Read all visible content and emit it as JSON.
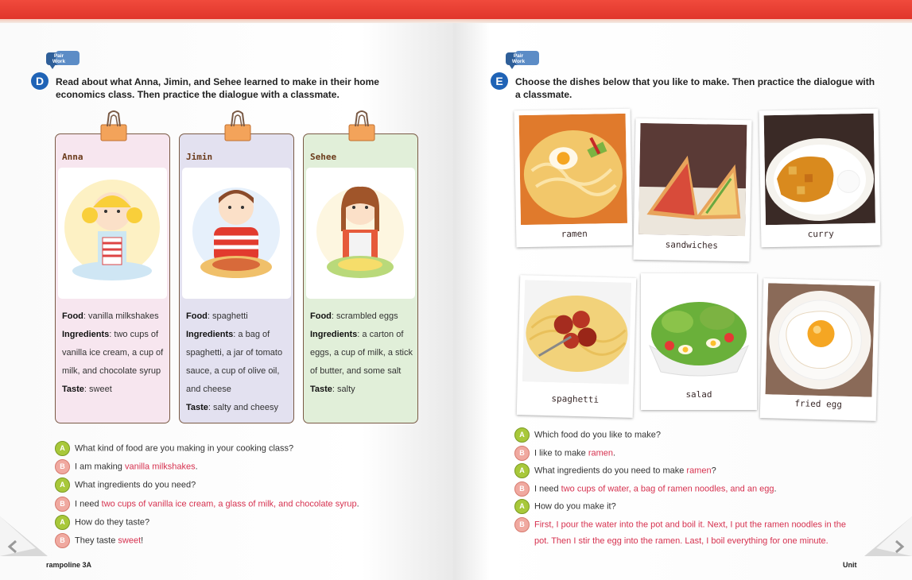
{
  "left": {
    "pair_label": "Pair\nWork",
    "letter": "D",
    "instruction": "Read about what Anna, Jimin, and Sehee learned to make in their home economics class. Then practice the dialogue with a classmate.",
    "cards": [
      {
        "name": "Anna",
        "food_label": "Food",
        "food": ": vanilla milkshakes",
        "ing_label": "Ingredients",
        "ing": ": two cups of vanilla ice cream, a cup of milk, and chocolate syrup",
        "taste_label": "Taste",
        "taste": ": sweet",
        "color": "#f7e6ef"
      },
      {
        "name": "Jimin",
        "food_label": "Food",
        "food": ": spaghetti",
        "ing_label": "Ingredients",
        "ing": ": a bag of spaghetti, a jar of tomato sauce,  a cup of olive oil, and cheese",
        "taste_label": "Taste",
        "taste": ": salty and cheesy",
        "color": "#e3e1f0"
      },
      {
        "name": "Sehee",
        "food_label": "Food",
        "food": ": scrambled eggs",
        "ing_label": "Ingredients",
        "ing": ": a carton of eggs, a cup of milk, a stick of butter, and some salt",
        "taste_label": "Taste",
        "taste": ": salty",
        "color": "#e1efd9"
      }
    ],
    "dialogue": [
      {
        "s": "A",
        "pre": "What kind of food are you making in your cooking class?",
        "hl": "",
        "post": ""
      },
      {
        "s": "B",
        "pre": "I am making ",
        "hl": "vanilla milkshakes",
        "post": "."
      },
      {
        "s": "A",
        "pre": "What ingredients do you need?",
        "hl": "",
        "post": ""
      },
      {
        "s": "B",
        "pre": "I need ",
        "hl": "two cups of vanilla ice cream, a glass of milk, and chocolate syrup",
        "post": "."
      },
      {
        "s": "A",
        "pre": "How do they taste?",
        "hl": "",
        "post": ""
      },
      {
        "s": "B",
        "pre": "They taste ",
        "hl": "sweet",
        "post": "!"
      }
    ],
    "footer": "rampoline 3A"
  },
  "right": {
    "pair_label": "Pair\nWork",
    "letter": "E",
    "instruction": "Choose the dishes below that you like to make. Then practice the dialogue with a classmate.",
    "photos": [
      "ramen",
      "sandwiches",
      "curry",
      "spaghetti",
      "salad",
      "fried egg"
    ],
    "dialogue": [
      {
        "s": "A",
        "pre": "Which food do you like to make?",
        "hl": "",
        "post": ""
      },
      {
        "s": "B",
        "pre": "I like to make ",
        "hl": "ramen",
        "post": "."
      },
      {
        "s": "A",
        "pre": "What ingredients do you need to make ",
        "hl": "ramen",
        "post": "?"
      },
      {
        "s": "B",
        "pre": "I need ",
        "hl": "two cups of water, a bag of ramen noodles, and an egg",
        "post": "."
      },
      {
        "s": "A",
        "pre": "How do you make it?",
        "hl": "",
        "post": ""
      },
      {
        "s": "B",
        "pre": "",
        "hl": "First, I pour the water into the pot and boil it. Next, I put the ramen noodles in the",
        "post": ""
      },
      {
        "s": "",
        "pre": "",
        "hl": "pot. Then I stir the egg into the ramen. Last, I boil everything for one minute.",
        "post": ""
      }
    ],
    "footer": "Unit"
  }
}
